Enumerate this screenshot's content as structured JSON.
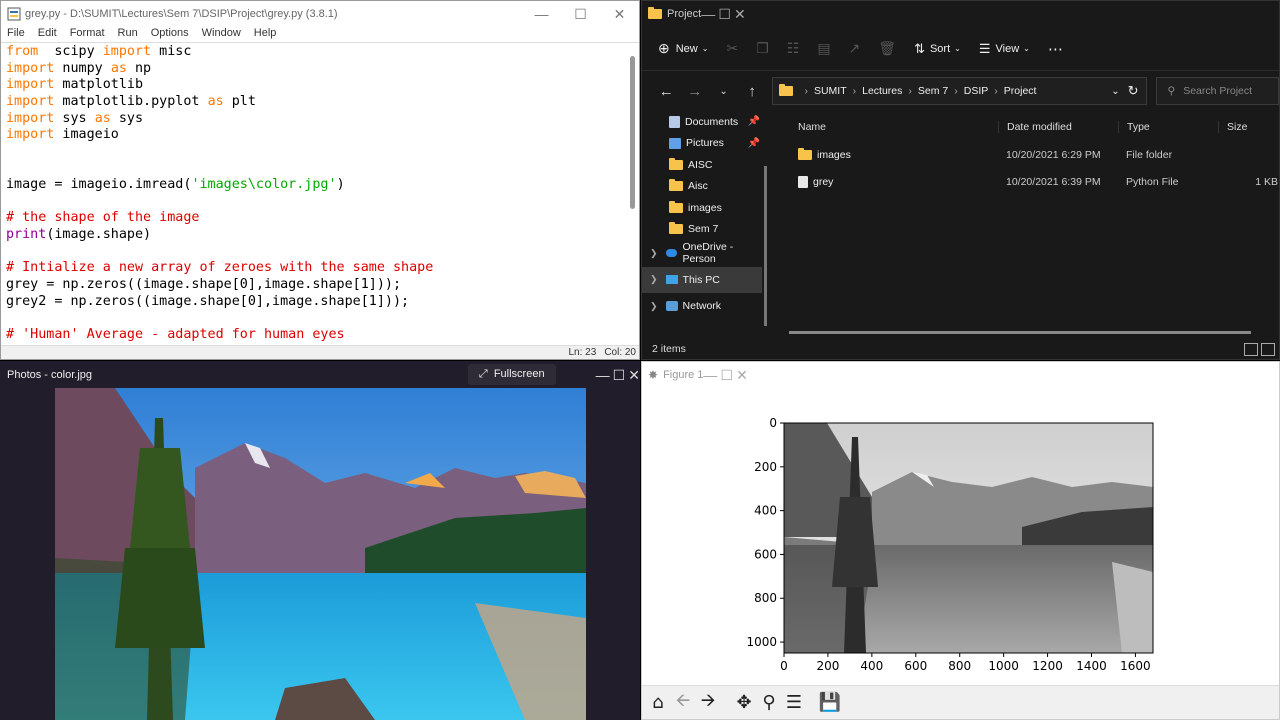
{
  "idle": {
    "title": "grey.py - D:\\SUMIT\\Lectures\\Sem 7\\DSIP\\Project\\grey.py (3.8.1)",
    "menu": [
      "File",
      "Edit",
      "Format",
      "Run",
      "Options",
      "Window",
      "Help"
    ],
    "status_ln": "Ln: 23",
    "status_col": "Col: 20",
    "code_lines": [
      [
        [
          "kw",
          "from"
        ],
        [
          "",
          "  scipy "
        ],
        [
          "kw",
          "import"
        ],
        [
          "",
          " misc"
        ]
      ],
      [
        [
          "kw",
          "import"
        ],
        [
          "",
          " numpy "
        ],
        [
          "kw",
          "as"
        ],
        [
          "",
          " np"
        ]
      ],
      [
        [
          "kw",
          "import"
        ],
        [
          "",
          " matplotlib"
        ]
      ],
      [
        [
          "kw",
          "import"
        ],
        [
          "",
          " matplotlib.pyplot "
        ],
        [
          "kw",
          "as"
        ],
        [
          "",
          " plt"
        ]
      ],
      [
        [
          "kw",
          "import"
        ],
        [
          "",
          " sys "
        ],
        [
          "kw",
          "as"
        ],
        [
          "",
          " sys"
        ]
      ],
      [
        [
          "kw",
          "import"
        ],
        [
          "",
          " imageio"
        ]
      ],
      [],
      [],
      [
        [
          "",
          "image = imageio.imread("
        ],
        [
          "st",
          "'images\\color.jpg'"
        ],
        [
          "",
          ")"
        ]
      ],
      [],
      [
        [
          "cm",
          "# the shape of the image"
        ]
      ],
      [
        [
          "bi",
          "print"
        ],
        [
          "",
          "(image.shape)"
        ]
      ],
      [],
      [
        [
          "cm",
          "# Intialize a new array of zeroes with the same shape"
        ]
      ],
      [
        [
          "",
          "grey = np.zeros((image.shape[0],image.shape[1]));"
        ]
      ],
      [
        [
          "",
          "grey2 = np.zeros((image.shape[0],image.shape[1]));"
        ]
      ],
      [],
      [
        [
          "cm",
          "# 'Human' Average - adapted for human eyes"
        ]
      ]
    ]
  },
  "explorer": {
    "title": "Project",
    "toolbar": {
      "new": "New",
      "sort": "Sort",
      "view": "View"
    },
    "breadcrumb": [
      "SUMIT",
      "Lectures",
      "Sem 7",
      "DSIP",
      "Project"
    ],
    "search_placeholder": "Search Project",
    "nav": [
      {
        "label": "Documents",
        "icon": "documents-icon",
        "pinned": true
      },
      {
        "label": "Pictures",
        "icon": "pictures-icon",
        "pinned": true
      },
      {
        "label": "AISC",
        "icon": "folder-icon",
        "pinned": false
      },
      {
        "label": "Aisc",
        "icon": "folder-icon",
        "pinned": false
      },
      {
        "label": "images",
        "icon": "folder-icon",
        "pinned": false
      },
      {
        "label": "Sem 7",
        "icon": "folder-icon",
        "pinned": false
      }
    ],
    "groups": [
      "OneDrive - Person",
      "This PC",
      "Network"
    ],
    "columns": [
      "Name",
      "Date modified",
      "Type",
      "Size"
    ],
    "files": [
      {
        "name": "images",
        "date": "10/20/2021 6:29 PM",
        "type": "File folder",
        "size": ""
      },
      {
        "name": "grey",
        "date": "10/20/2021 6:39 PM",
        "type": "Python File",
        "size": "1 KB"
      }
    ],
    "status": "2 items"
  },
  "photos": {
    "title": "Photos - color.jpg",
    "fullscreen": "Fullscreen"
  },
  "figure": {
    "title": "Figure 1",
    "chart_data": {
      "type": "image",
      "xticks": [
        "0",
        "200",
        "400",
        "600",
        "800",
        "1000",
        "1200",
        "1400",
        "1600"
      ],
      "yticks": [
        "0",
        "200",
        "400",
        "600",
        "800",
        "1000"
      ],
      "xlim": [
        0,
        1680
      ],
      "ylim": [
        1050,
        0
      ]
    }
  }
}
